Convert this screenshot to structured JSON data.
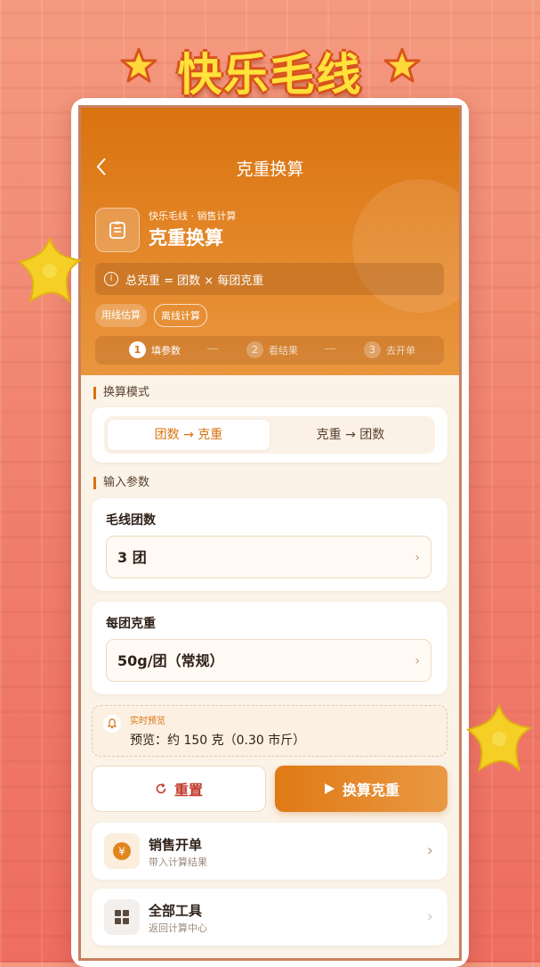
{
  "banner": {
    "title": "快乐毛线"
  },
  "header": {
    "title": "克重换算"
  },
  "hero": {
    "breadcrumb": "快乐毛线 · 销售计算",
    "title": "克重换算",
    "formula": "总克重 = 团数 × 每团克重",
    "chips": [
      "用线估算",
      "离线计算"
    ],
    "steps": [
      {
        "num": "1",
        "label": "填参数"
      },
      {
        "num": "2",
        "label": "看结果"
      },
      {
        "num": "3",
        "label": "去开单"
      }
    ]
  },
  "mode": {
    "label": "换算模式",
    "options": [
      "团数 → 克重",
      "克重 → 团数"
    ],
    "selected": "团数 → 克重"
  },
  "params": {
    "label": "输入参数",
    "skeins": {
      "label": "毛线团数",
      "value": "3 团"
    },
    "weight": {
      "label": "每团克重",
      "value": "50g/团（常规）"
    }
  },
  "preview": {
    "title": "实时预览",
    "text": "预览：约 150 克（0.30 市斤）"
  },
  "actions": {
    "reset": "重置",
    "calc": "换算克重"
  },
  "links": [
    {
      "title": "销售开单",
      "subtitle": "带入计算结果",
      "icon": "yuan-icon"
    },
    {
      "title": "全部工具",
      "subtitle": "返回计算中心",
      "icon": "grid-icon"
    }
  ],
  "colors": {
    "accent": "#d9730f",
    "background": "#f07e6c",
    "star": "#f7d21e"
  }
}
